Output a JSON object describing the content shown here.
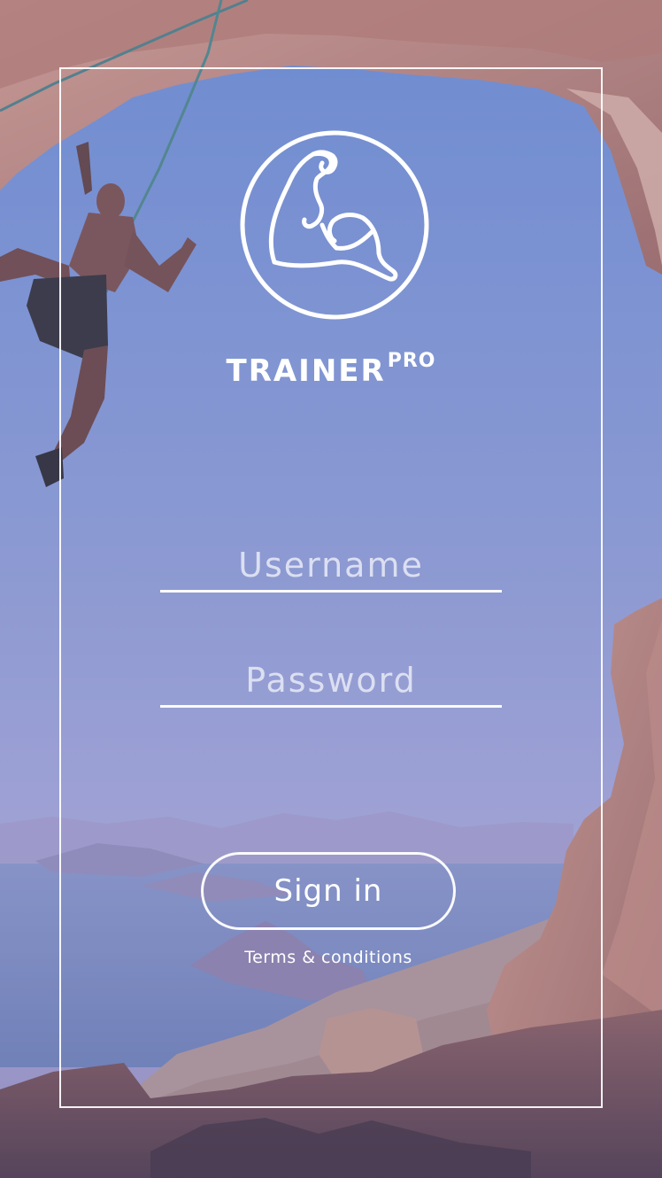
{
  "brand": {
    "name": "TRAINER",
    "superscript": "PRO",
    "logo_icon": "flexed-biceps-icon"
  },
  "login": {
    "username_placeholder": "Username",
    "password_placeholder": "Password",
    "signin_label": "Sign in",
    "terms_label": "Terms & conditions"
  },
  "colors": {
    "overlay": "#7c8fd6",
    "foreground": "#ffffff"
  }
}
